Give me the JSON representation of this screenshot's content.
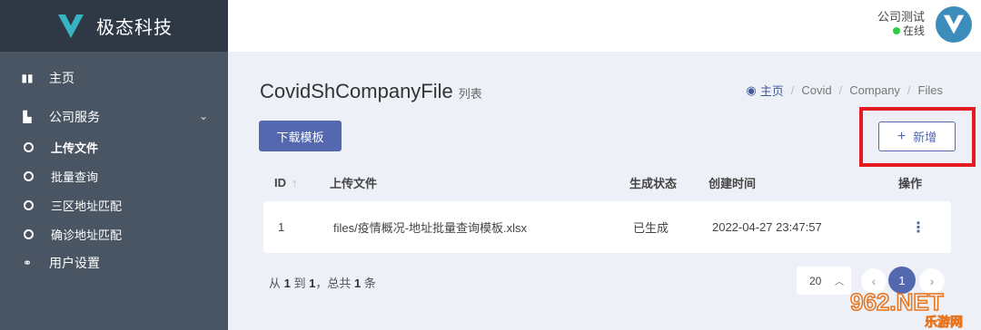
{
  "brand": {
    "name": "极态科技"
  },
  "sidebar": {
    "items": [
      {
        "label": "主页",
        "icon": "bar-chart-icon"
      },
      {
        "label": "公司服务",
        "icon": "building-icon"
      },
      {
        "label": "用户设置",
        "icon": "link-icon"
      }
    ],
    "submenu": [
      {
        "label": "上传文件",
        "active": true
      },
      {
        "label": "批量查询"
      },
      {
        "label": "三区地址匹配"
      },
      {
        "label": "确诊地址匹配"
      }
    ]
  },
  "user": {
    "name": "公司测试",
    "status": "在线"
  },
  "page": {
    "title": "CovidShCompanyFile",
    "subtitle": "列表"
  },
  "breadcrumb": [
    "主页",
    "Covid",
    "Company",
    "Files"
  ],
  "toolbar": {
    "template_label": "下载模板",
    "new_label": "新增",
    "new_plus": "+"
  },
  "table": {
    "headers": {
      "id": "ID",
      "file": "上传文件",
      "status": "生成状态",
      "time": "创建时间",
      "ops": "操作"
    },
    "rows": [
      {
        "id": "1",
        "file": "files/疫情概况-地址批量查询模板.xlsx",
        "status": "已生成",
        "time": "2022-04-27 23:47:57"
      }
    ]
  },
  "pagination": {
    "info_prefix": "从",
    "from": "1",
    "to_word": "到",
    "to": "1",
    "total_word": "，总共",
    "total": "1",
    "unit": "条",
    "per_page": "20",
    "current": "1"
  },
  "watermark": {
    "text": "962.NET",
    "sub": "乐游网"
  },
  "colors": {
    "primary": "#5468b0",
    "sidebar": "#4a5563",
    "sidebar_dark": "#2f3845",
    "highlight": "#e41b22",
    "online": "#2ecc40"
  }
}
